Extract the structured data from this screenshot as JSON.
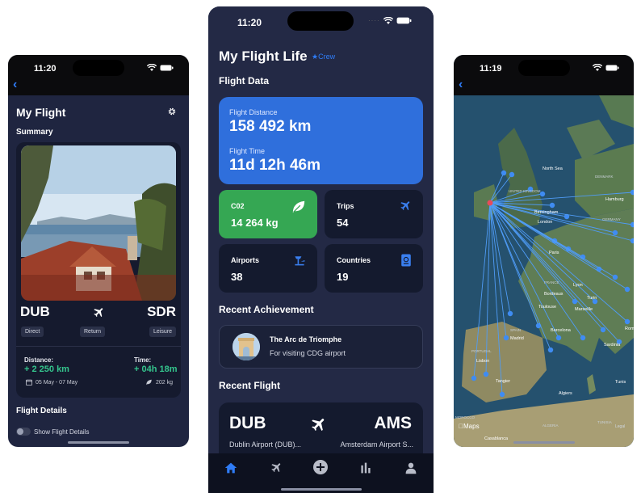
{
  "left_phone": {
    "status_time": "11:20",
    "title": "My Flight",
    "summary_label": "Summary",
    "origin": "DUB",
    "destination": "SDR",
    "tags": [
      "Direct",
      "Return",
      "Leisure"
    ],
    "distance_label": "Distance:",
    "distance_value": "+ 2 250 km",
    "time_label": "Time:",
    "time_value": "+ 04h 18m",
    "dates": "05 May - 07 May",
    "co2": "202 kg",
    "details_heading": "Flight Details",
    "show_details_label": "Show Flight Details"
  },
  "center_phone": {
    "status_time": "11:20",
    "title": "My Flight Life",
    "crew_badge": "★Crew",
    "flight_data_heading": "Flight Data",
    "distance_label": "Flight Distance",
    "distance_value": "158 492 km",
    "time_label": "Flight Time",
    "time_value": "11d 12h 46m",
    "tiles": [
      {
        "label": "C02",
        "value": "14 264 kg"
      },
      {
        "label": "Trips",
        "value": "54"
      },
      {
        "label": "Airports",
        "value": "38"
      },
      {
        "label": "Countries",
        "value": "19"
      }
    ],
    "achievement_heading": "Recent Achievement",
    "achievement_title": "The Arc de Triomphe",
    "achievement_subtitle": "For visiting CDG airport",
    "recent_heading": "Recent Flight",
    "recent_origin_code": "DUB",
    "recent_dest_code": "AMS",
    "recent_origin_name": "Dublin Airport (DUB)...",
    "recent_dest_name": "Amsterdam Airport S..."
  },
  "right_phone": {
    "status_time": "11:19",
    "map_labels": [
      "UNITED KINGDOM",
      "Birmingham",
      "London",
      "Paris",
      "FRANCE",
      "Lyon",
      "Bordeaux",
      "Toulouse",
      "Marseille",
      "Turin",
      "Barcelona",
      "Madrid",
      "SPAIN",
      "PORTUGAL",
      "Lisbon",
      "Tangier",
      "Algiers",
      "Tunis",
      "Casablanca",
      "MOROCCO",
      "ALGERIA",
      "TUNISIA",
      "Sardinia",
      "GERMANY",
      "Hamburg",
      "DENMARK",
      "North Sea",
      "Rom"
    ],
    "maps_brand": "Maps",
    "legal": "Legal"
  },
  "colors": {
    "accent_blue": "#2f6fdc",
    "green": "#35a753",
    "positive": "#34c58d",
    "background": "#232945"
  }
}
